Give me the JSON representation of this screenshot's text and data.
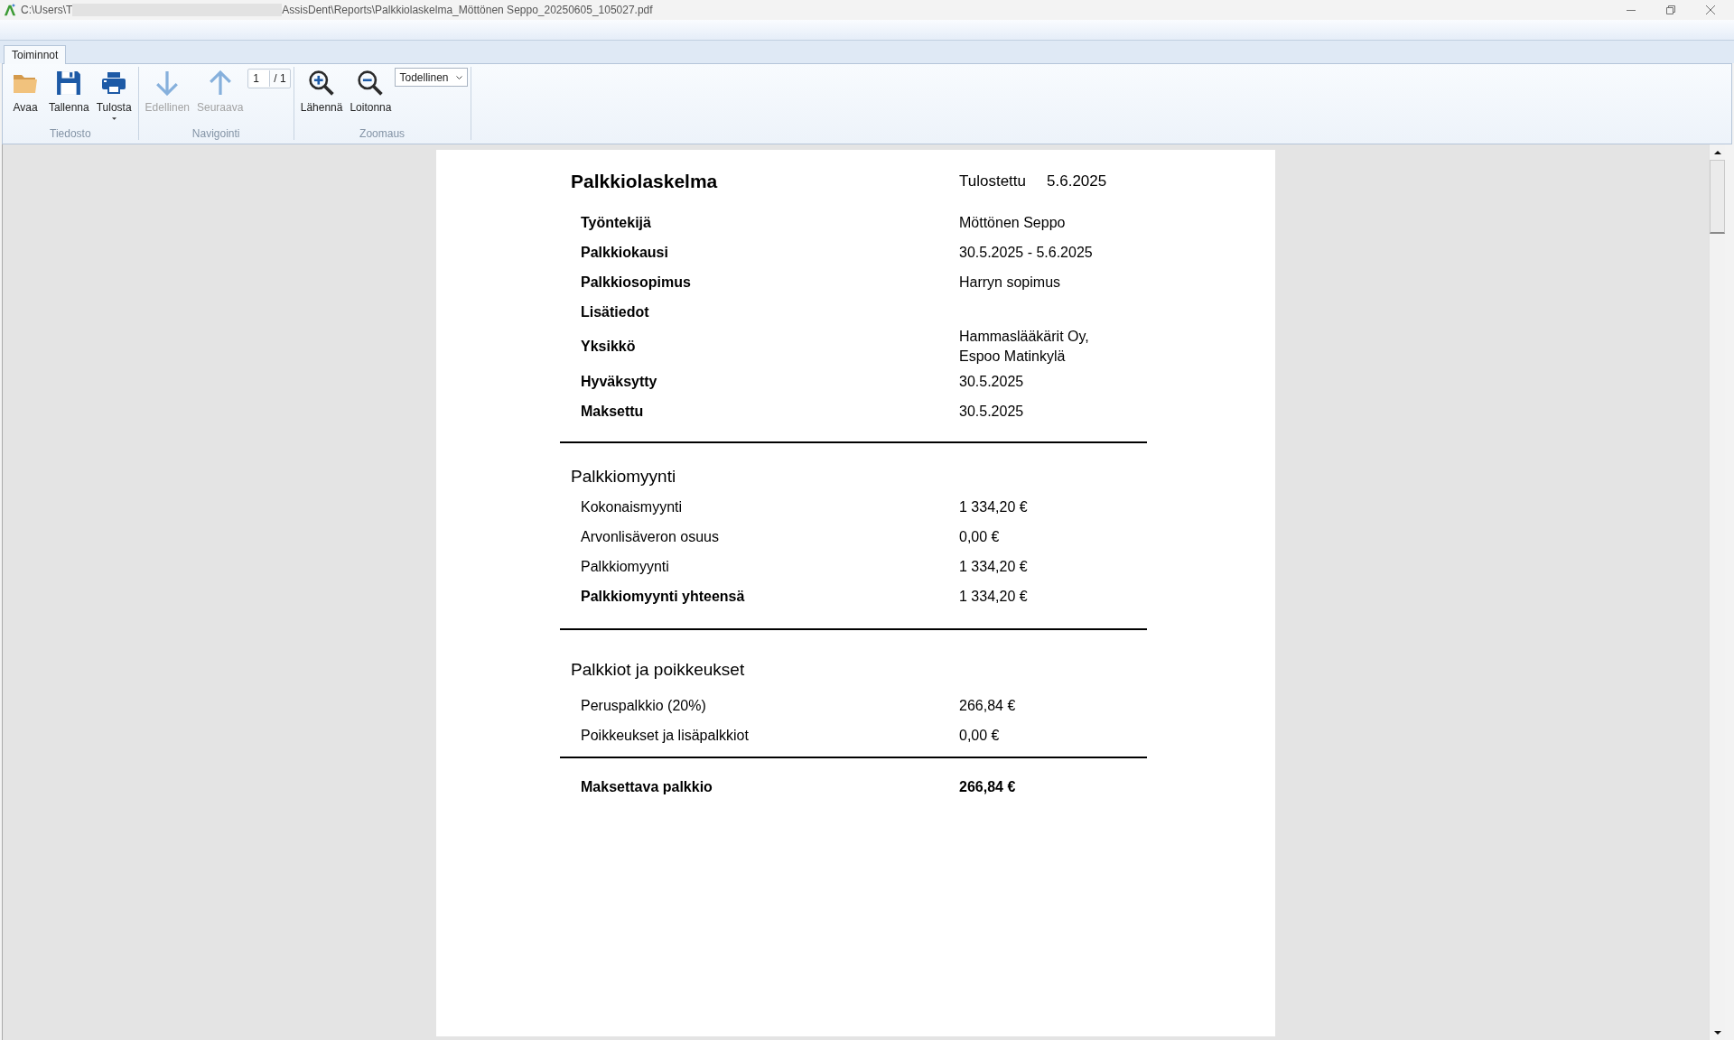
{
  "window": {
    "title_parts": [
      "C:\\Users\\T",
      "AssisDent\\Reports\\Palkkiolaskelma_Möttönen Seppo_20250605_105027.pdf"
    ]
  },
  "ribbon": {
    "tabs": [
      {
        "label": "Toiminnot",
        "selected": true
      }
    ],
    "groups": [
      {
        "label": "Tiedosto",
        "items": [
          {
            "kind": "open",
            "label": "Avaa",
            "disabled": false,
            "has_menu": false
          },
          {
            "kind": "save",
            "label": "Tallenna",
            "disabled": false,
            "has_menu": false
          },
          {
            "kind": "print",
            "label": "Tulosta",
            "disabled": false,
            "has_menu": true
          }
        ]
      },
      {
        "label": "Navigointi",
        "items": [
          {
            "kind": "previous",
            "label": "Edellinen",
            "disabled": true,
            "has_menu": false
          },
          {
            "kind": "next",
            "label": "Seuraava",
            "disabled": true,
            "has_menu": false
          },
          {
            "kind": "page_field",
            "value": "1",
            "total": "/ 1"
          }
        ]
      },
      {
        "label": "Zoomaus",
        "items": [
          {
            "kind": "zoom_in",
            "label": "Lähennä",
            "disabled": false,
            "has_menu": false
          },
          {
            "kind": "zoom_out",
            "label": "Loitonna",
            "disabled": false,
            "has_menu": false
          },
          {
            "kind": "dropdown",
            "value": "Todellinen"
          }
        ]
      }
    ]
  },
  "document": {
    "title": "Palkkiolaskelma",
    "printed": {
      "label": "Tulostettu",
      "date": "5.6.2025"
    },
    "details": [
      {
        "label": "Työntekijä",
        "value": "Möttönen Seppo"
      },
      {
        "label": "Palkkiokausi",
        "value": "30.5.2025 - 5.6.2025"
      },
      {
        "label": "Palkkiosopimus",
        "value": "Harryn sopimus"
      },
      {
        "label": "Lisätiedot"
      },
      {
        "label": "Yksikkö",
        "value": "Hammaslääkärit Oy, Espoo Matinkylä"
      },
      {
        "label": "Hyväksytty",
        "value": "30.5.2025"
      },
      {
        "label": "Maksettu",
        "value": "30.5.2025"
      }
    ],
    "sections": [
      {
        "heading": "Palkkiomyynti",
        "rows": [
          {
            "label": "Kokonaismyynti",
            "value": "1 334,20 €",
            "label_bold": false
          },
          {
            "label": "Arvonlisäveron osuus",
            "value": "0,00 €",
            "label_bold": false
          },
          {
            "label": "Palkkiomyynti",
            "value": "1 334,20 €",
            "label_bold": false
          },
          {
            "label": "Palkkiomyynti yhteensä",
            "value": "1 334,20 €",
            "label_bold": true
          }
        ]
      },
      {
        "heading": "Palkkiot ja poikkeukset",
        "rows": [
          {
            "label": "Peruspalkkio (20%)",
            "value": "266,84 €",
            "label_bold": false
          },
          {
            "label": "Poikkeukset ja lisäpalkkiot",
            "value": "0,00 €",
            "label_bold": false
          }
        ]
      }
    ],
    "total": {
      "label": "Maksettava palkkio",
      "value": "266,84 €"
    }
  }
}
